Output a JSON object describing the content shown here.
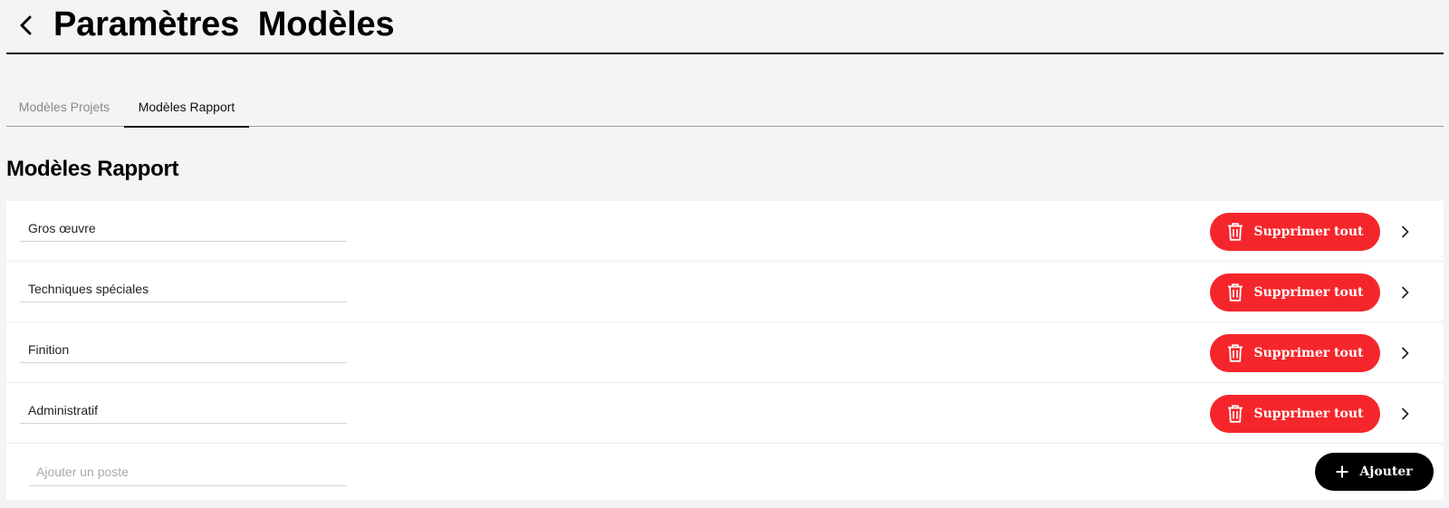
{
  "header": {
    "title": "Paramètres  Modèles",
    "back_icon": "chevron-left-icon"
  },
  "tabs": [
    {
      "label": "Modèles Projets",
      "active": false
    },
    {
      "label": "Modèles Rapport",
      "active": true
    }
  ],
  "section": {
    "title": "Modèles Rapport"
  },
  "rows": [
    {
      "name": "Gros œuvre",
      "delete_label": "Supprimer tout"
    },
    {
      "name": "Techniques spéciales",
      "delete_label": "Supprimer tout"
    },
    {
      "name": "Finition",
      "delete_label": "Supprimer tout"
    },
    {
      "name": "Administratif",
      "delete_label": "Supprimer tout"
    }
  ],
  "add": {
    "placeholder": "Ajouter un poste",
    "value": "",
    "button_label": "Ajouter"
  },
  "colors": {
    "danger": "#f5262b",
    "primary_button": "#000000",
    "background": "#f4f4f6"
  }
}
